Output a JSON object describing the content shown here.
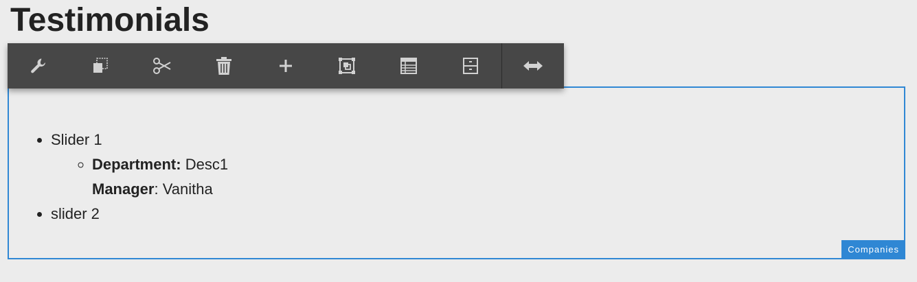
{
  "page": {
    "title": "Testimonials"
  },
  "toolbar": {
    "icon_color": "#d2d2d2",
    "buttons": [
      {
        "icon": "wrench-icon"
      },
      {
        "icon": "copy-icon"
      },
      {
        "icon": "scissors-icon"
      },
      {
        "icon": "trash-icon"
      },
      {
        "icon": "plus-icon"
      },
      {
        "icon": "group-icon"
      },
      {
        "icon": "table-icon"
      },
      {
        "icon": "cabinet-icon"
      },
      {
        "icon": "resize-horizontal-icon"
      }
    ]
  },
  "component": {
    "badge": "Companies",
    "border_color": "#2f87d4",
    "items": [
      {
        "label": "Slider 1",
        "department_label": "Department:",
        "department_value": " Desc1",
        "manager_label": "Manager",
        "manager_value": ": Vanitha"
      },
      {
        "label": "slider 2"
      }
    ]
  }
}
